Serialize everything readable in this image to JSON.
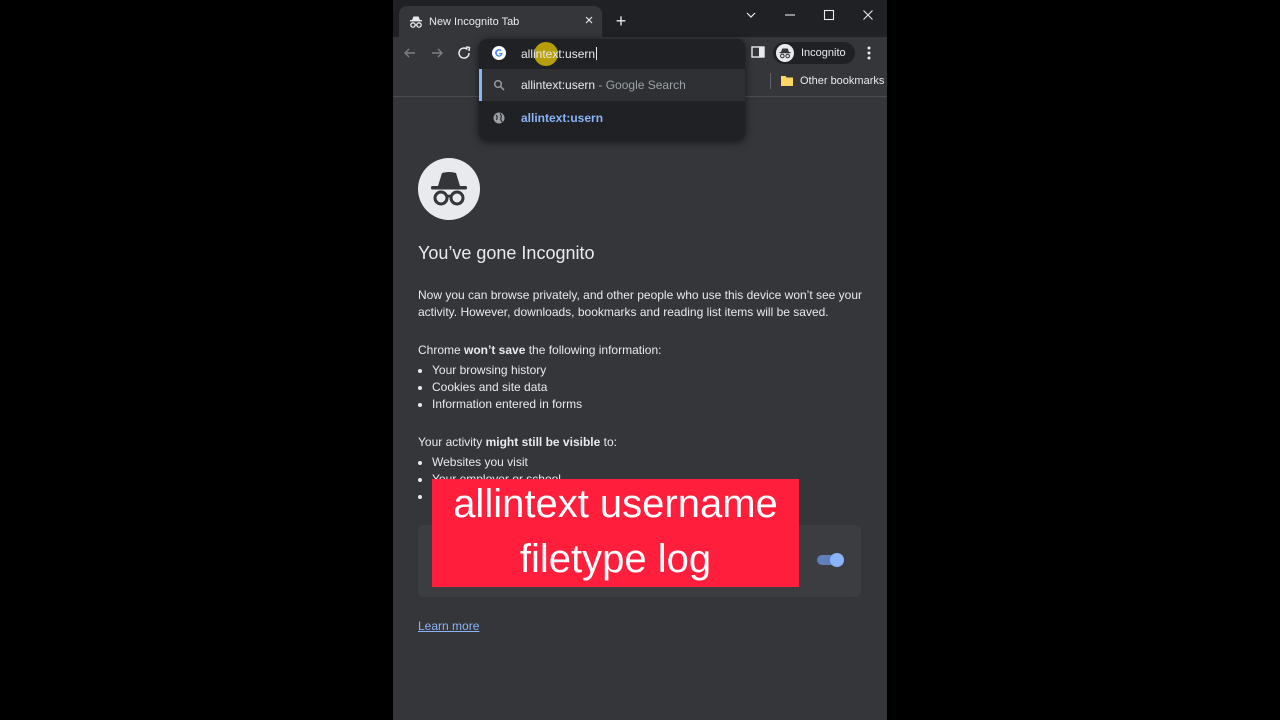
{
  "tab": {
    "title": "New Incognito Tab",
    "close_glyph": "×"
  },
  "newtab_glyph": "+",
  "omnibox": {
    "query": "allintext:usern",
    "suggestions": [
      {
        "text": "allintext:usern",
        "sub": " - Google Search",
        "icon": "search-icon"
      },
      {
        "text": "allintext:usern",
        "sub": "",
        "icon": "globe-icon"
      }
    ]
  },
  "profile": {
    "label": "Incognito"
  },
  "bookmarks": {
    "other": "Other bookmarks"
  },
  "page": {
    "heading": "You’ve gone Incognito",
    "intro": "Now you can browse privately, and other people who use this device won’t see your activity. However, downloads, bookmarks and reading list items will be saved.",
    "not_saved_prefix": "Chrome ",
    "not_saved_bold": "won’t save",
    "not_saved_suffix": " the following information:",
    "not_saved_items": [
      "Your browsing history",
      "Cookies and site data",
      "Information entered in forms"
    ],
    "visible_prefix": "Your activity ",
    "visible_bold": "might still be visible",
    "visible_suffix": " to:",
    "visible_items": [
      "Websites you visit",
      "Your employer or school",
      ""
    ],
    "learn_more": "Learn more"
  },
  "caption": {
    "line1": "allintext username",
    "line2": "filetype log"
  },
  "colors": {
    "accent": "#8ab4f8",
    "caption_bg": "#ff1e3c",
    "frame": "#202124",
    "page_bg": "#35363a"
  }
}
